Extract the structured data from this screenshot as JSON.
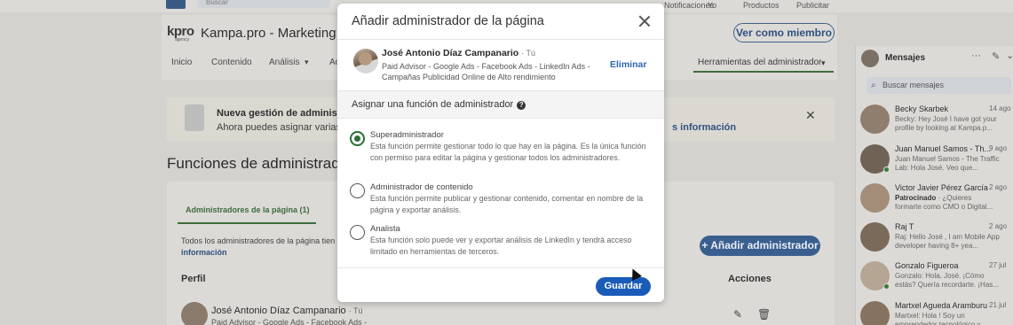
{
  "topbar": {
    "search_placeholder": "Buscar",
    "nav_items": [
      "Notificaciones",
      "Yo",
      "Productos",
      "Publicitar"
    ]
  },
  "page": {
    "logo_text": "kpro",
    "logo_sub": "agency",
    "company_name": "Kampa.pro - Marketing ba",
    "view_as_member": "Ver como miembro",
    "tabs": [
      "Inicio",
      "Contenido",
      "Análisis",
      "Ac"
    ],
    "admin_tools_tab": "Herramientas del administrador"
  },
  "notice": {
    "title": "Nueva gestión de administra",
    "subtitle": "Ahora puedes asignar varias",
    "link": "s información"
  },
  "roles_section": {
    "title": "Funciones de administrador",
    "tab_label": "Administradores de la página (1)",
    "description": "Todos los administradores de la página tien",
    "description_link": "información",
    "add_admin_button": "Añadir administrador",
    "col_profile": "Perfil",
    "col_actions": "Acciones",
    "row_name": "José Antonio Díaz Campanario",
    "row_degree": "· Tú",
    "row_headline": "Paid Advisor - Google Ads - Facebook Ads -"
  },
  "messaging": {
    "title": "Mensajes",
    "search_placeholder": "Buscar mensajes",
    "conversations": [
      {
        "name": "Becky Skarbek",
        "date": "14 ago",
        "text": "Becky: Hey José I have got your profile by looking at Kampa.p...",
        "online": false
      },
      {
        "name": "Juan Manuel Samos - Th...",
        "date": "9 ago",
        "text": "Juan Manuel Samos - The Traffic Lab: Hola José. Veo que...",
        "online": true
      },
      {
        "name": "Victor Javier Pérez García",
        "date": "2 ago",
        "sponsored": "Patrocinado",
        "text": "· ¿Quieres formarte como CMO o Digital...",
        "online": false
      },
      {
        "name": "Raj T",
        "date": "2 ago",
        "text": "Raj: Hello José , I am Mobile App developer having 8+ yea...",
        "online": false
      },
      {
        "name": "Gonzalo Figueroa",
        "date": "27 jul",
        "text": "Gonzalo: Hola, José. ¡Cómo estás? Quería recordarte. ¡Has...",
        "online": true
      },
      {
        "name": "Martxel Agueda Aramburu",
        "date": "21 jul",
        "text": "Martxel: Hola ! Soy un emprendedor tecnológico y...",
        "online": false
      }
    ]
  },
  "modal": {
    "title": "Añadir administrador de la página",
    "profile": {
      "name": "José Antonio Díaz Campanario",
      "degree": "· Tú",
      "headline": "Paid Advisor - Google Ads - Facebook Ads - LinkedIn Ads - Campañas Publicidad Online de Alto rendimiento",
      "remove_label": "Eliminar"
    },
    "role_prompt": "Asignar una función de administrador",
    "roles": [
      {
        "title": "Superadministrador",
        "description": "Esta función permite gestionar todo lo que hay en la página. Es la única función con permiso para editar la página y gestionar todos los administradores.",
        "selected": true
      },
      {
        "title": "Administrador de contenido",
        "description": "Esta función permite publicar y gestionar contenido, comentar en nombre de la página y exportar análisis.",
        "selected": false
      },
      {
        "title": "Analista",
        "description": "Esta función solo puede ver y exportar análisis de LinkedIn y tendrá acceso limitado en herramientas de terceros.",
        "selected": false
      }
    ],
    "save_label": "Guardar"
  },
  "colors": {
    "primary_blue": "#1a5bb8",
    "selected_green": "#2c6e35",
    "link_blue": "#2e64b0"
  }
}
